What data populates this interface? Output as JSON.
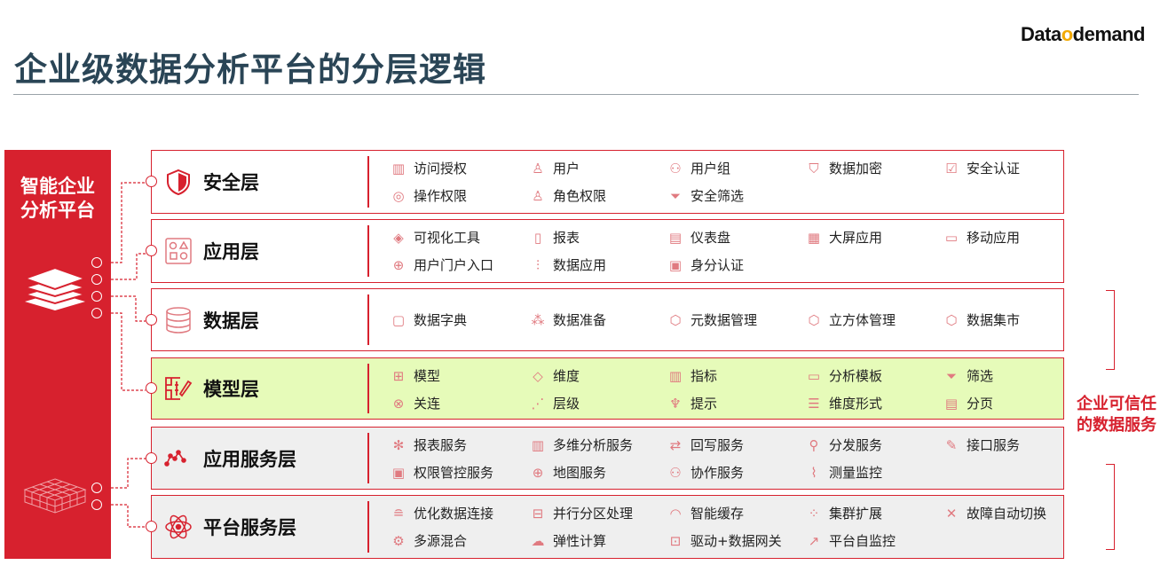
{
  "title": "企业级数据分析平台的分层逻辑",
  "logo": {
    "part1": "Data",
    "part2": "o",
    "part3": "demand",
    "text": "Data on demand"
  },
  "panel": {
    "line1": "智能企业",
    "line2": "分析平台"
  },
  "right_label": {
    "line1": "企业可信任",
    "line2": "的数据服务"
  },
  "colors": {
    "accent": "#d7212e",
    "title": "#2a4556",
    "model_bg": "#e6fbb9",
    "service_bg": "#efefef"
  },
  "layers": [
    {
      "name": "安全层",
      "icon": "shield-icon",
      "items": [
        {
          "label": "访问授权",
          "icon": "chart-icon"
        },
        {
          "label": "用户",
          "icon": "user-icon"
        },
        {
          "label": "用户组",
          "icon": "users-icon"
        },
        {
          "label": "数据加密",
          "icon": "shield-icon"
        },
        {
          "label": "安全认证",
          "icon": "checklist-icon"
        },
        {
          "label": "操作权限",
          "icon": "target-icon"
        },
        {
          "label": "角色权限",
          "icon": "user-icon"
        },
        {
          "label": "安全筛选",
          "icon": "filter-icon"
        }
      ]
    },
    {
      "name": "应用层",
      "icon": "shapes-icon",
      "items": [
        {
          "label": "可视化工具",
          "icon": "tag-icon"
        },
        {
          "label": "报表",
          "icon": "document-icon"
        },
        {
          "label": "仪表盘",
          "icon": "dashboard-icon"
        },
        {
          "label": "大屏应用",
          "icon": "screen-icon"
        },
        {
          "label": "移动应用",
          "icon": "mobile-icon"
        },
        {
          "label": "用户门户入口",
          "icon": "globe-icon"
        },
        {
          "label": "数据应用",
          "icon": "bars-icon"
        },
        {
          "label": "身分认证",
          "icon": "id-icon"
        }
      ]
    },
    {
      "name": "数据层",
      "icon": "database-icon",
      "items": [
        {
          "label": "数据字典",
          "icon": "book-icon"
        },
        {
          "label": "数据准备",
          "icon": "prep-icon"
        },
        {
          "label": "元数据管理",
          "icon": "cube-icon"
        },
        {
          "label": "立方体管理",
          "icon": "cube-icon"
        },
        {
          "label": "数据集市",
          "icon": "cube-icon"
        }
      ]
    },
    {
      "name": "模型层",
      "icon": "model-edit-icon",
      "items": [
        {
          "label": "模型",
          "icon": "model-icon"
        },
        {
          "label": "维度",
          "icon": "diamond-icon"
        },
        {
          "label": "指标",
          "icon": "metric-icon"
        },
        {
          "label": "分析模板",
          "icon": "template-icon"
        },
        {
          "label": "筛选",
          "icon": "filter-icon"
        },
        {
          "label": "关连",
          "icon": "link-icon"
        },
        {
          "label": "层级",
          "icon": "hierarchy-icon"
        },
        {
          "label": "提示",
          "icon": "hint-icon"
        },
        {
          "label": "维度形式",
          "icon": "list-icon"
        },
        {
          "label": "分页",
          "icon": "page-icon"
        }
      ]
    },
    {
      "name": "应用服务层",
      "icon": "line-chart-icon",
      "items": [
        {
          "label": "报表服务",
          "icon": "gear-icon"
        },
        {
          "label": "多维分析服务",
          "icon": "bar-chart-icon"
        },
        {
          "label": "回写服务",
          "icon": "swap-icon"
        },
        {
          "label": "分发服务",
          "icon": "share-icon"
        },
        {
          "label": "接口服务",
          "icon": "plug-icon"
        },
        {
          "label": "权限管控服务",
          "icon": "id-icon"
        },
        {
          "label": "地图服务",
          "icon": "globe-icon"
        },
        {
          "label": "协作服务",
          "icon": "team-icon"
        },
        {
          "label": "测量监控",
          "icon": "monitor-icon"
        }
      ]
    },
    {
      "name": "平台服务层",
      "icon": "atom-icon",
      "items": [
        {
          "label": "优化数据连接",
          "icon": "database-icon"
        },
        {
          "label": "并行分区处理",
          "icon": "partition-icon"
        },
        {
          "label": "智能缓存",
          "icon": "gauge-icon"
        },
        {
          "label": "集群扩展",
          "icon": "cluster-icon"
        },
        {
          "label": "故障自动切换",
          "icon": "tools-icon"
        },
        {
          "label": "多源混合",
          "icon": "gears-icon"
        },
        {
          "label": "弹性计算",
          "icon": "cloud-icon"
        },
        {
          "label": "驱动+数据网关",
          "icon": "lock-icon"
        },
        {
          "label": "平台自监控",
          "icon": "trend-icon"
        }
      ]
    }
  ]
}
